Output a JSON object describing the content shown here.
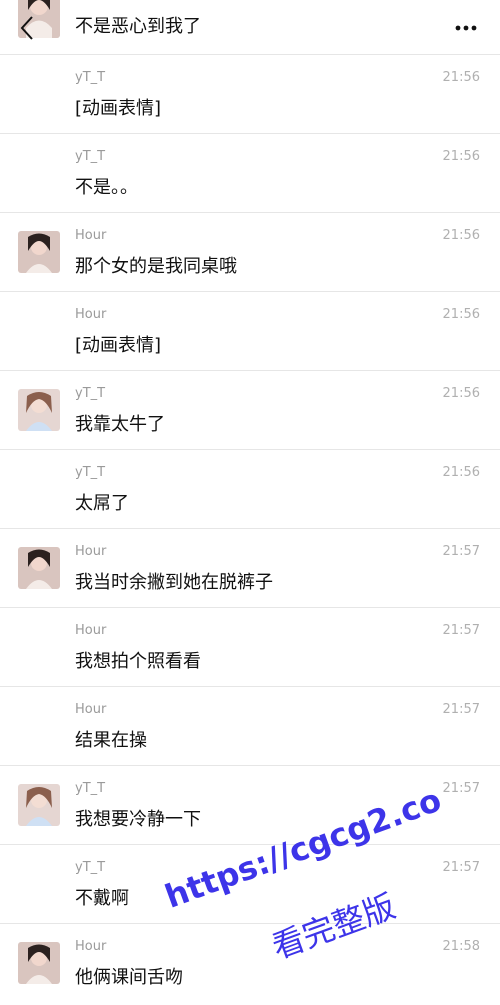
{
  "header": {
    "first_text": "不是恶心到我了",
    "more_label": "•••"
  },
  "messages": [
    {
      "sender": "yT_T",
      "time": "21:56",
      "text": "[动画表情]",
      "avatar": "none"
    },
    {
      "sender": "yT_T",
      "time": "21:56",
      "text": "不是。。",
      "avatar": "none"
    },
    {
      "sender": "Hour",
      "time": "21:56",
      "text": "那个女的是我同桌哦",
      "avatar": "hour"
    },
    {
      "sender": "Hour",
      "time": "21:56",
      "text": "[动画表情]",
      "avatar": "none"
    },
    {
      "sender": "yT_T",
      "time": "21:56",
      "text": "我靠太牛了",
      "avatar": "yt"
    },
    {
      "sender": "yT_T",
      "time": "21:56",
      "text": "太屌了",
      "avatar": "none"
    },
    {
      "sender": "Hour",
      "time": "21:57",
      "text": "我当时余撇到她在脱裤子",
      "avatar": "hour"
    },
    {
      "sender": "Hour",
      "time": "21:57",
      "text": "我想拍个照看看",
      "avatar": "none"
    },
    {
      "sender": "Hour",
      "time": "21:57",
      "text": "结果在操",
      "avatar": "none"
    },
    {
      "sender": "yT_T",
      "time": "21:57",
      "text": "我想要冷静一下",
      "avatar": "yt"
    },
    {
      "sender": "yT_T",
      "time": "21:57",
      "text": "不戴啊",
      "avatar": "none"
    },
    {
      "sender": "Hour",
      "time": "21:58",
      "text": "他俩课间舌吻",
      "avatar": "hour"
    }
  ],
  "watermark": {
    "url": "https://cgcg2.co",
    "cta": "看完整版"
  },
  "colors": {
    "sender": "#9a9a9a",
    "time": "#b0b0b0",
    "text": "#111111",
    "divider": "#e6e6e6",
    "watermark": "#3d34e9"
  }
}
